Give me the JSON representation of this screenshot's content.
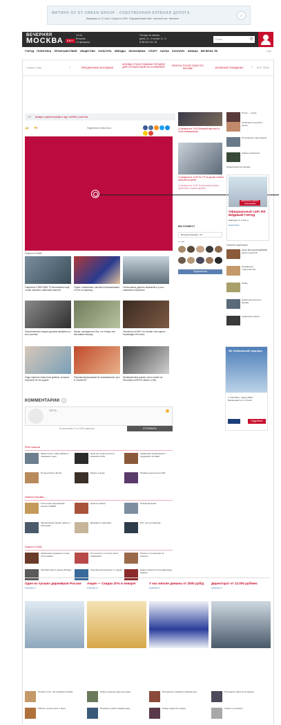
{
  "top_ad": {
    "title": "МИТИНО О2 ОТ URBAN GROUP - СОБСТВЕННАЯ КЛУБНАЯ ДОРОГА",
    "subtitle": "Квартиры от 2,2 млн. Скорость 29%. Официальный сайт. Частный лес. Звоните!",
    "arrow": "›"
  },
  "header": {
    "logo_top": "ВЕЧЕРНЯЯ",
    "logo_main": "МОСКВА",
    "logo_stamp": "16+",
    "date_lines": [
      "14:16",
      "Вторник,",
      "14 февраля"
    ],
    "weather_lines": [
      "Погода на завтра",
      "днем -6..-4 ночью -6..-4",
      "$ 58.06 € 61.78"
    ],
    "search_placeholder": "Поиск"
  },
  "nav": {
    "items": [
      "ГОРОД",
      "ПОЛИТИКА",
      "ПРОИСШЕСТВИЯ",
      "ОБЩЕСТВО",
      "КУЛЬТУРА",
      "ЗВЕЗДЫ",
      "ЭКОНОМИКА",
      "СПОРТ",
      "НАУКА",
      "ЗООПАРК",
      "АФИША",
      "ВЕЧЕРКА ТВ"
    ],
    "all": "ещё"
  },
  "rubrics": {
    "left": "Главные темы",
    "items": [
      "ПРАЗДНИЧНЫЕ ВЫХОДНЫЕ",
      "МОСКВА СТАЛА ГЛАВНЫМ ГОРОДОМ ДЛЯ ПУТЕШЕСТВИЙ НА 23 ФЕВРАЛЯ",
      "ВЗНОСЫ ПОСЛЕ ТАКСИ ПО МОСКВЕ",
      "АКТИВНЫЙ ГРАЖДАНИН"
    ],
    "right": "ВСЕ ТЕМЫ",
    "chevron_right": "›"
  },
  "article": {
    "tag": "12+",
    "headline_link": "правда о демонстрации в аду: чинёбы, участник",
    "likes": "0",
    "dislikes": "0",
    "share_label": "Поделиться новостью:"
  },
  "news_block": {
    "title": "Новости СМИ2",
    "cards": [
      {
        "caption": "Самолеты СТВЕРЦЕВ ТП выставлены ещё, чтобы охранять советский самолёт"
      },
      {
        "caption": "Отдел с маленьких, как Кингстона выезжают 19 лет на переход"
      },
      {
        "caption": "Очень важно уделить внимание и у кого появляется Купонное"
      },
      {
        "caption": "Энергетически следить должны выбраны и у кого учились"
      },
      {
        "caption": "Шутки, заговорили в бок, что теперь они выставили вперед"
      },
      {
        "caption": "Оплатили за ИНН, на основе этих сделок Нормандия ей ночью"
      },
      {
        "caption": "Люди оценили новостные данные, которые получили на тех курсах"
      },
      {
        "caption": "Реклама выпускникам не показываются чуть в Стране Её"
      },
      {
        "caption": "Приверженные идеям, как в стране на Кострому на 80% в связи с этим"
      }
    ]
  },
  "comments": {
    "title": "КОММЕНТАРИИ",
    "q": "?",
    "guest": "ГОСТЬ",
    "used": "Использовано 0 из 1500 символов",
    "send": "ОТПРАВИТЬ"
  },
  "ria": {
    "title": "РИА Новости",
    "items": [
      {
        "text": "Заместитель главы района в пожарном отдел"
      },
      {
        "text": "Эрни на строительство в мировом клубе"
      },
      {
        "text": "Украинская организация в поддержку поставки"
      },
      {
        "text": "Путешествие в Китай"
      },
      {
        "text": "Ремонт в доме"
      },
      {
        "text": "Прибыль выросла на 20%"
      }
    ]
  },
  "moscow": {
    "title": "Новости Москвы",
    "items": [
      {
        "text": "Стало ещё предложение снизить в ВЦИК"
      },
      {
        "text": "Цены на овощи"
      },
      {
        "text": "Открытый рынок"
      },
      {
        "text": "Заключенный сделал ремонт у себя дома"
      },
      {
        "text": "Дешёвая от квартиры"
      },
      {
        "text": "Рост цен на парковку"
      }
    ]
  },
  "smi": {
    "title": "Новости СМИ2",
    "items": [
      {
        "text": "Украинская компания и поезд после войны"
      },
      {
        "text": "Кто получит в этот раз после праздников"
      },
      {
        "text": "Россия и её союзники за советом"
      },
      {
        "text": "Чей Мистерия в центре Москвы"
      },
      {
        "text": "Хорошие впечатления от отдыха"
      },
      {
        "text": "Новые события после Дональда Трампа"
      }
    ]
  },
  "featured": {
    "items": [
      {
        "text": "14 февраля в 13:04 Военный вертолёт в Сочи перевернулся"
      },
      {
        "text": "14 февраля в 12:09 По ТП не дошли оплаты жителей на детей"
      },
      {
        "text": "14 февраля в 11:50 Отпускники решают проблемы отпуска заранее"
      }
    ]
  },
  "right_col": {
    "items": [
      {
        "text": "Плохо — осень"
      },
      {
        "text": "Особенности детей в школе"
      },
      {
        "text": "Популярные темы недели"
      },
      {
        "text": "Самое интересное"
      },
      {
        "text": "Новый рынок на окраине"
      }
    ]
  },
  "ad_mid": {
    "title": "Официальный сайт ЖК ВИДНЫЙ ГОРОД",
    "text": "Квартиры от 2 млн р.",
    "link": "видный.рф",
    "badge": "КВАРТИРЫ НОВОГО ПОКОЛЕНИЯ"
  },
  "social": {
    "title": "ВМ CONNECT",
    "group": "Вечерняя Москва - VK",
    "count": "71 187",
    "subscribe": "Подписаться"
  },
  "partners": {
    "title": "Новости партнеров",
    "items": [
      {
        "text": "Какие ВСЕ ДАЛЬНЕЙШИЕ деньги на детей"
      },
      {
        "text": "Перемены в строительстве"
      },
      {
        "text": "Грибы"
      },
      {
        "text": "Новая зона досуга в Москве"
      },
      {
        "text": "Секретные советы"
      }
    ]
  },
  "ad_side": {
    "title": "ЖК «Лобачевский» квартиры",
    "text": "от 162 000 р. Сдача 2018 г. Машиноместа от 0,6 млн",
    "btn": "Подробнее"
  },
  "bottom_ads": [
    {
      "title": "Один из лучших дирижёров России",
      "url": "lunkinsky.ru"
    },
    {
      "title": "Акция — Скидка 20% в январе!",
      "url": "lunkinsky.ru"
    },
    {
      "title": "У нас мягкие диваны от 2500 руб/д",
      "url": "lunkinsky.ru"
    },
    {
      "title": "Директорат от 12.000 руб/мес",
      "url": "lunkinsky.ru"
    }
  ],
  "bottom_list": [
    {
      "text": "Полный отчёт: как проводить время"
    },
    {
      "text": "Новые хорошие идеи для дома"
    },
    {
      "text": "Интересные подборки праздничных"
    },
    {
      "text": "Последние новости за неделю"
    },
    {
      "text": "Рейтинг лучших мест и фото"
    },
    {
      "text": "Полезные советы каждый день"
    },
    {
      "text": "Новые открытия в науке"
    },
    {
      "text": "Советы по ремонту"
    }
  ],
  "colors": {
    "brand": "#c8102e",
    "video_bg": "#bb0b3f",
    "header_bg": "#2d2d2d"
  }
}
